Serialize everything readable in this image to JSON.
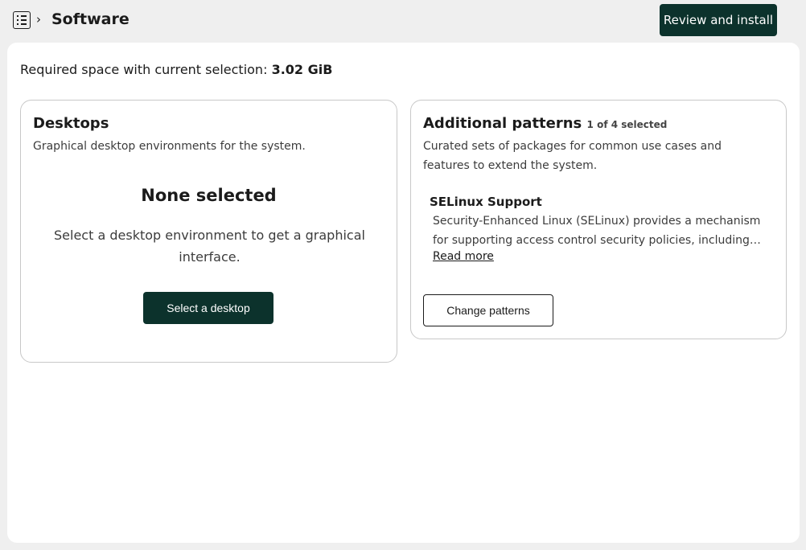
{
  "header": {
    "breadcrumb_separator": "›",
    "title": "Software",
    "review_button": "Review and install"
  },
  "summary": {
    "label": "Required space with current selection:",
    "value": "3.02 GiB"
  },
  "desktops": {
    "title": "Desktops",
    "description": "Graphical desktop environments for the system.",
    "empty_title": "None selected",
    "empty_help": "Select a desktop environment to get a graphical interface.",
    "select_button": "Select a desktop"
  },
  "patterns": {
    "title": "Additional patterns",
    "count": "1 of 4 selected",
    "description": "Curated sets of packages for common use cases and features to extend the system.",
    "item_name": "SELinux Support",
    "item_description": "Security-Enhanced Linux (SELinux) provides a mechanism for supporting access control security policies, including…",
    "read_more": "Read more",
    "change_button": "Change patterns"
  },
  "icons": {
    "menu": "sidebar-menu-icon"
  },
  "colors": {
    "primary": "#0c322c",
    "background": "#efefef",
    "card_border": "#c8c8c8"
  }
}
